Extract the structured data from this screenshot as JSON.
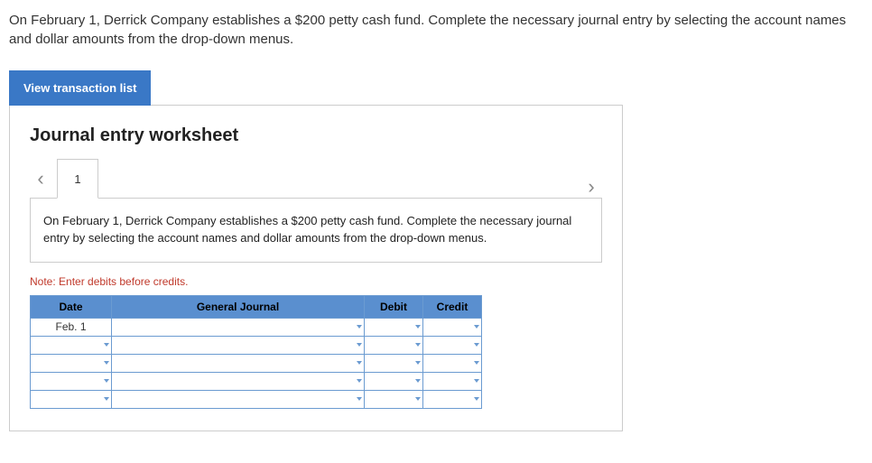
{
  "question": "On February 1, Derrick Company establishes a $200 petty cash fund. Complete the necessary journal entry by selecting the account names and dollar amounts from the drop-down menus.",
  "buttons": {
    "view_list": "View transaction list"
  },
  "worksheet": {
    "title": "Journal entry worksheet",
    "nav": {
      "prev": "‹",
      "next": "›",
      "tab": "1"
    },
    "prompt": "On February 1, Derrick Company establishes a $200 petty cash fund. Complete the necessary journal entry by selecting the account names and dollar amounts from the drop-down menus.",
    "note": "Note: Enter debits before credits.",
    "table": {
      "headers": {
        "date": "Date",
        "gj": "General Journal",
        "debit": "Debit",
        "credit": "Credit"
      },
      "rows": [
        {
          "date": "Feb. 1",
          "gj": "",
          "debit": "",
          "credit": ""
        },
        {
          "date": "",
          "gj": "",
          "debit": "",
          "credit": ""
        },
        {
          "date": "",
          "gj": "",
          "debit": "",
          "credit": ""
        },
        {
          "date": "",
          "gj": "",
          "debit": "",
          "credit": ""
        },
        {
          "date": "",
          "gj": "",
          "debit": "",
          "credit": ""
        }
      ]
    }
  }
}
